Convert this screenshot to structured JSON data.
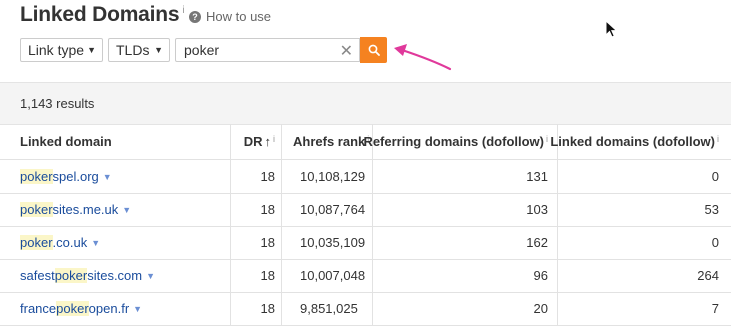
{
  "title": "Linked Domains",
  "title_info": "i",
  "how_to_use": "How to use",
  "filters": {
    "link_type": "Link type",
    "tlds": "TLDs",
    "search_value": "poker"
  },
  "results_count": "1,143 results",
  "columns": {
    "domain": "Linked domain",
    "dr": "DR",
    "ahrefs_rank": "Ahrefs rank",
    "referring": "Referring domains (dofollow)",
    "linked": "Linked domains (dofollow)"
  },
  "rows": [
    {
      "pre": "",
      "hl": "poker",
      "post": "spel.org",
      "dr": "18",
      "rank": "10,108,129",
      "ref": "131",
      "linked": "0"
    },
    {
      "pre": "",
      "hl": "poker",
      "post": "sites.me.uk",
      "dr": "18",
      "rank": "10,087,764",
      "ref": "103",
      "linked": "53"
    },
    {
      "pre": "",
      "hl": "poker",
      "post": ".co.uk",
      "dr": "18",
      "rank": "10,035,109",
      "ref": "162",
      "linked": "0"
    },
    {
      "pre": "safest",
      "hl": "poker",
      "post": "sites.com",
      "dr": "18",
      "rank": "10,007,048",
      "ref": "96",
      "linked": "264"
    },
    {
      "pre": "france",
      "hl": "poker",
      "post": "open.fr",
      "dr": "18",
      "rank": "9,851,025",
      "ref": "20",
      "linked": "7"
    }
  ],
  "colors": {
    "accent": "#f58220",
    "link": "#1a4c9c",
    "annotation_arrow": "#e0399b"
  },
  "icons": {
    "search": "search-icon",
    "clear": "close-icon",
    "help": "question-icon"
  }
}
